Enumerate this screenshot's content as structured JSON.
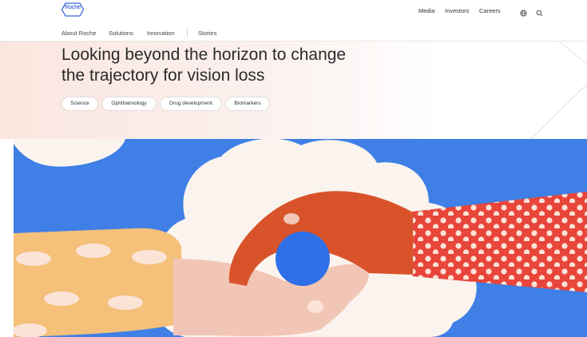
{
  "header": {
    "logo_text": "Roche",
    "logo_icon": "roche-hexagon-logo",
    "links": [
      "Media",
      "Investors",
      "Careers"
    ],
    "icons": [
      "globe-icon",
      "search-icon"
    ]
  },
  "subnav": {
    "items": [
      "About Roche",
      "Solutions",
      "Innovation"
    ],
    "stories": "Stories"
  },
  "hero": {
    "title_line1": "Looking beyond the horizon to change",
    "title_line2": "the trajectory for vision loss",
    "tags": [
      "Science",
      "Ophthalmology",
      "Drug development",
      "Biomarkers"
    ]
  },
  "colors": {
    "brand_blue": "#0b41cd",
    "sky_blue": "#3f7fe6",
    "cloud": "#fbf4ee",
    "hand_orange": "#d9532a",
    "sleeve_red": "#e8453b",
    "sleeve_yellow": "#f4c07a",
    "skin": "#f2c6b6",
    "pupil_blue": "#2f6fe8"
  }
}
